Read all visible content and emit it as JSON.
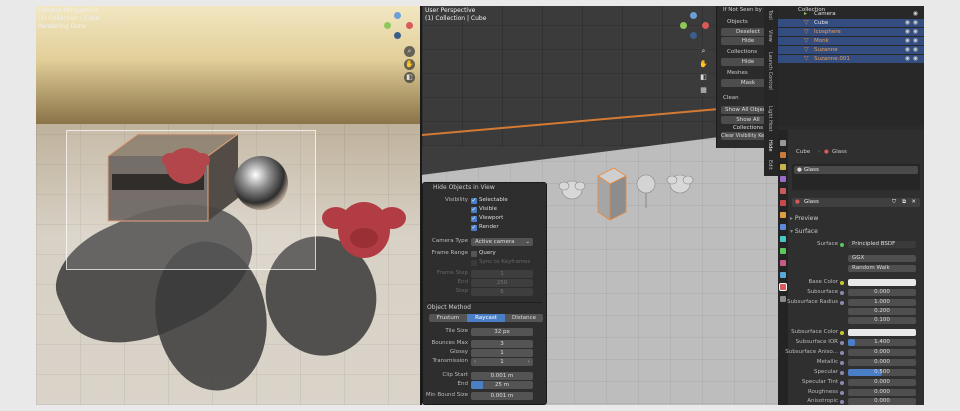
{
  "left_viewport": {
    "title": "Camera Perspective",
    "collection": "(1) Collection | Cube",
    "status": "Rendering Done"
  },
  "mid_viewport": {
    "title": "User Perspective",
    "collection": "(1) Collection | Cube"
  },
  "overlay": {
    "title": "Hide Objects in View",
    "visibility_label": "Visibility",
    "checks": [
      {
        "label": "Selectable",
        "on": true
      },
      {
        "label": "Visible",
        "on": true
      },
      {
        "label": "Viewport",
        "on": true
      },
      {
        "label": "Render",
        "on": true
      }
    ],
    "camera_type_label": "Camera Type",
    "camera_type_value": "Active camera",
    "frame_range_label": "Frame Range",
    "frame_range_value": "Query",
    "sync_label": "Sync to Keyframes",
    "frame_step_label": "Frame Step",
    "frame_step_value": "1",
    "end_label": "End",
    "end_value": "250",
    "step_label": "Step",
    "step_value": "5",
    "object_method_label": "Object Method",
    "methods": [
      "Frustum",
      "Raycast",
      "Distance"
    ],
    "tile_size_label": "Tile Size",
    "tile_size_value": "32 px",
    "bounces_label": "Bounces Max",
    "bounces_value": "3",
    "glossy_label": "Glossy",
    "glossy_value": "1",
    "transmission_label": "Transmission",
    "transmission_value": "1",
    "clip_start_label": "Clip Start",
    "clip_start_value": "0.001 m",
    "clip_end_label": "End",
    "clip_end_value": "25 m",
    "min_bound_label": "Min Bound Size",
    "min_bound_value": "0.001 m"
  },
  "npanel": {
    "header": "If Not Seen by the Camera...",
    "objects_label": "Objects",
    "deselect": "Deselect",
    "hide1": "Hide",
    "collections_label": "Collections",
    "hide2": "Hide",
    "meshes_label": "Meshes",
    "mask": "Mask",
    "clean_label": "Clean",
    "show_all_objects": "Show All Objects",
    "show_all_collections": "Show All Collections",
    "clear_keyframes": "Clear Visibility Keyframes"
  },
  "sidetabs": [
    "Tool",
    "View",
    "Launch Control",
    "Light Host",
    "Hide",
    "Edit"
  ],
  "outliner": {
    "root": "Collection",
    "items": [
      "Camera",
      "Cube",
      "Icosphere",
      "Monk",
      "Suzanne",
      "Suzanne.001"
    ]
  },
  "props": {
    "object_name": "Cube",
    "material_tab": "Glass",
    "slot_name": "Glass",
    "material_name": "Glass",
    "preview": "Preview",
    "surface_section": "Surface",
    "surface_label": "Surface",
    "surface_value": "Principled BSDF",
    "distribution": "GGX",
    "subsurface_method": "Random Walk",
    "rows": [
      {
        "label": "Base Color",
        "value": "",
        "type": "color"
      },
      {
        "label": "Subsurface",
        "value": "0.000",
        "type": "num"
      },
      {
        "label": "Subsurface Radius",
        "value": "1.000",
        "type": "num"
      },
      {
        "label": "",
        "value": "0.200",
        "type": "num"
      },
      {
        "label": "",
        "value": "0.100",
        "type": "num"
      },
      {
        "label": "Subsurface Color",
        "value": "",
        "type": "color"
      },
      {
        "label": "Subsurface IOR",
        "value": "1.400",
        "type": "num"
      },
      {
        "label": "Subsurface Aniso...",
        "value": "0.000",
        "type": "num"
      },
      {
        "label": "Metallic",
        "value": "0.000",
        "type": "num"
      },
      {
        "label": "Specular",
        "value": "0.500",
        "type": "bar",
        "fill": 0.5
      },
      {
        "label": "Specular Tint",
        "value": "0.000",
        "type": "num"
      },
      {
        "label": "Roughness",
        "value": "0.000",
        "type": "num"
      },
      {
        "label": "Anisotropic",
        "value": "0.000",
        "type": "num"
      }
    ]
  }
}
